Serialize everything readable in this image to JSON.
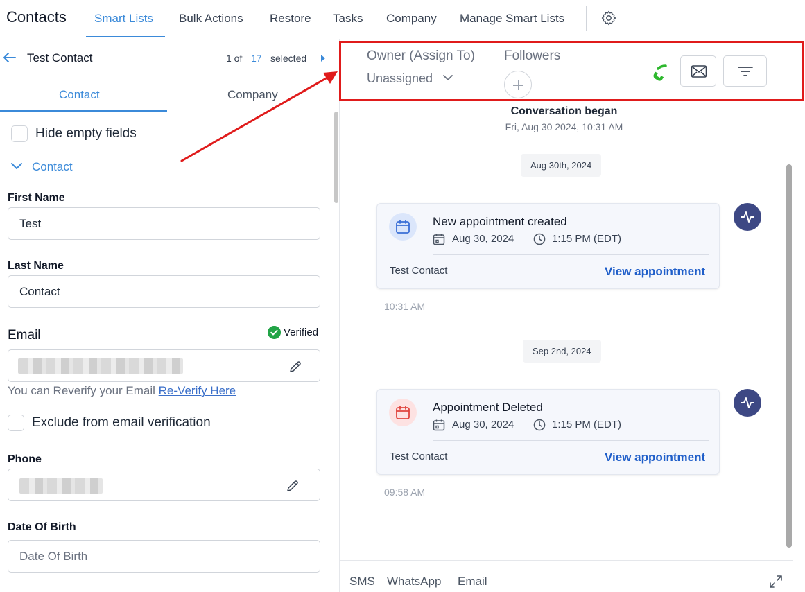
{
  "app": {
    "title": "Contacts"
  },
  "nav": {
    "items": [
      {
        "label": "Smart Lists"
      },
      {
        "label": "Bulk Actions"
      },
      {
        "label": "Restore"
      },
      {
        "label": "Tasks"
      },
      {
        "label": "Company"
      },
      {
        "label": "Manage Smart Lists"
      }
    ],
    "active": "Smart Lists",
    "settings_icon": "gear-icon"
  },
  "record": {
    "name": "Test Contact",
    "position_of": "1 of",
    "total": "17",
    "selected_label": "selected"
  },
  "subtabs": {
    "contact": "Contact",
    "company": "Company"
  },
  "left": {
    "hide_empty": "Hide empty fields",
    "section_title": "Contact",
    "fields": {
      "first_name_label": "First Name",
      "first_name_value": "Test",
      "last_name_label": "Last Name",
      "last_name_value": "Contact",
      "email_label": "Email",
      "verified_label": "Verified",
      "reverify_text": "You can Reverify your Email",
      "reverify_link": "Re-Verify Here",
      "exclude_label": "Exclude from email verification",
      "phone_label": "Phone",
      "dob_label": "Date Of Birth",
      "dob_placeholder": "Date Of Birth"
    }
  },
  "right": {
    "owner_label": "Owner (Assign To)",
    "owner_value": "Unassigned",
    "followers_label": "Followers",
    "conversation_began": "Conversation began",
    "conversation_date": "Fri, Aug 30 2024, 10:31 AM",
    "events": [
      {
        "chip": "Aug 30th, 2024",
        "title": "New appointment created",
        "date": "Aug 30, 2024",
        "time": "1:15 PM (EDT)",
        "contact": "Test Contact",
        "link": "View appointment",
        "timestamp": "10:31 AM"
      },
      {
        "chip": "Sep 2nd, 2024",
        "title": "Appointment Deleted",
        "date": "Aug 30, 2024",
        "time": "1:15 PM (EDT)",
        "contact": "Test Contact",
        "link": "View appointment",
        "timestamp": "09:58 AM"
      }
    ],
    "compose_tabs": [
      "SMS",
      "WhatsApp",
      "Email"
    ]
  },
  "colors": {
    "accent": "#3b8ad9",
    "link": "#1f5ec9",
    "highlight": "#e01b1b",
    "phone_green": "#2eb82e",
    "verified_green": "#22a447",
    "activity_dot": "#3d4884",
    "created_icon_bg": "#dbe6fb",
    "deleted_icon_bg": "#fde2e2"
  }
}
